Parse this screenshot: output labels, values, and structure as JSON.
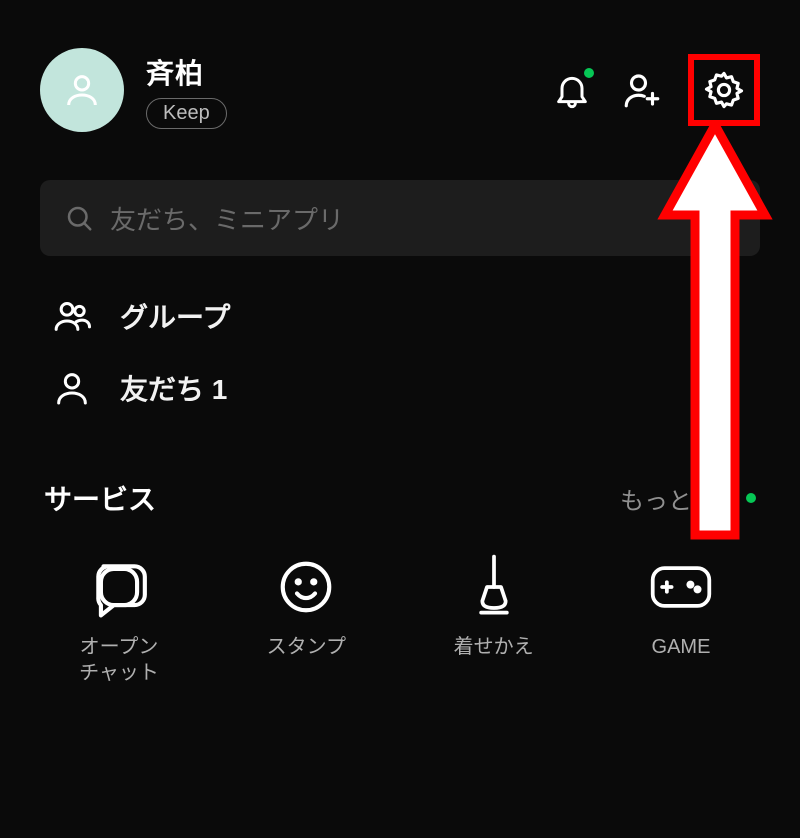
{
  "profile": {
    "name": "斉柏",
    "keep_label": "Keep"
  },
  "search": {
    "placeholder": "友だち、ミニアプリ"
  },
  "list": {
    "groups_label": "グループ",
    "friends_label": "友だち 1"
  },
  "section": {
    "title": "サービス",
    "more_label": "もっと見る"
  },
  "services": [
    {
      "label": "オープン\nチャット"
    },
    {
      "label": "スタンプ"
    },
    {
      "label": "着せかえ"
    },
    {
      "label": "GAME"
    }
  ],
  "colors": {
    "accent": "#06c755",
    "highlight": "#ff0000"
  }
}
